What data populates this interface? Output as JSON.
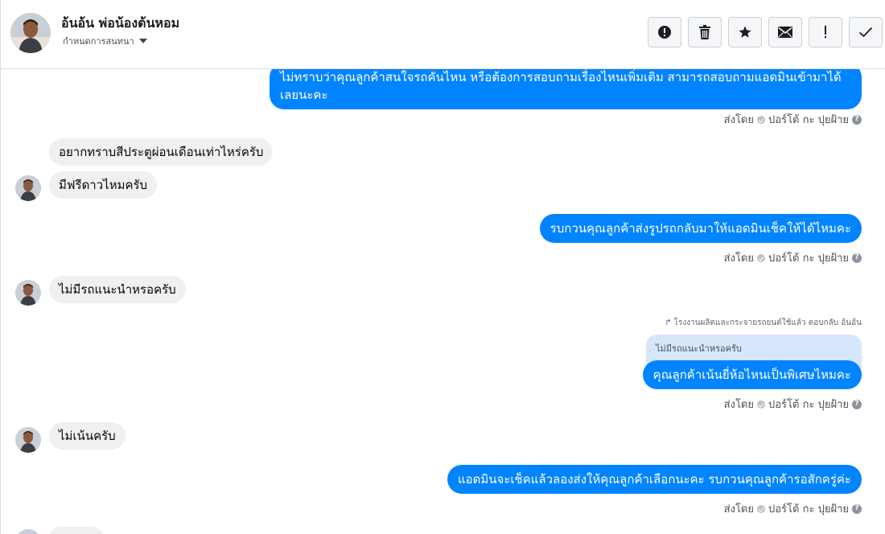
{
  "header": {
    "contact_name": "อ้นอ้น พ่อน้องต้นหอม",
    "subtitle": "กำหนดการสนทนา",
    "toolbar": [
      {
        "name": "report-spam-icon",
        "label": "!"
      },
      {
        "name": "trash-icon",
        "label": ""
      },
      {
        "name": "star-icon",
        "label": ""
      },
      {
        "name": "envelope-icon",
        "label": ""
      },
      {
        "name": "exclamation-icon",
        "label": "!"
      },
      {
        "name": "checkmark-icon",
        "label": ""
      }
    ]
  },
  "messages": {
    "m1": {
      "text": "ไม่ทราบว่าคุณลูกค้าสนใจรถคันไหน หรือต้องการสอบถามเรื่องไหนเพิ่มเติม สามารถสอบถามแอดมินเข้ามาได้เลยนะคะ"
    },
    "m2": {
      "text": "อยากทราบสีประตูผ่อนเดือนเท่าไหร่ครับ"
    },
    "m3": {
      "text": "มีฟรีดาวไหมครับ"
    },
    "m4": {
      "text": "รบกวนคุณลูกค้าส่งรูปรถกลับมาให้แอดมินเช็คให้ได้ไหมคะ"
    },
    "m5": {
      "text": "ไม่มีรถแนะนำหรอครับ"
    },
    "m6": {
      "reply_meta": "โรงงานผลิตและกระจายรถยนต์ใช้แล้ว ตอบกลับ อ้นอ้น",
      "quoted": "ไม่มีรถแนะนำหรอครับ",
      "text": "คุณลูกค้าเน้นยี่ห้อไหนเป็นพิเศษไหมคะ"
    },
    "m7": {
      "text": "ไม่เน้นครับ"
    },
    "m8": {
      "text": "แอดมินจะเช็คแล้วลองส่งให้คุณลูกค้าเลือกนะคะ รบกวนคุณลูกค้ารอสักครู่ค่ะ"
    }
  },
  "sent_by": {
    "prefix": "ส่งโดย",
    "sender": "ปอร์โต้ กะ ปุยฝ้าย",
    "help": "?"
  }
}
